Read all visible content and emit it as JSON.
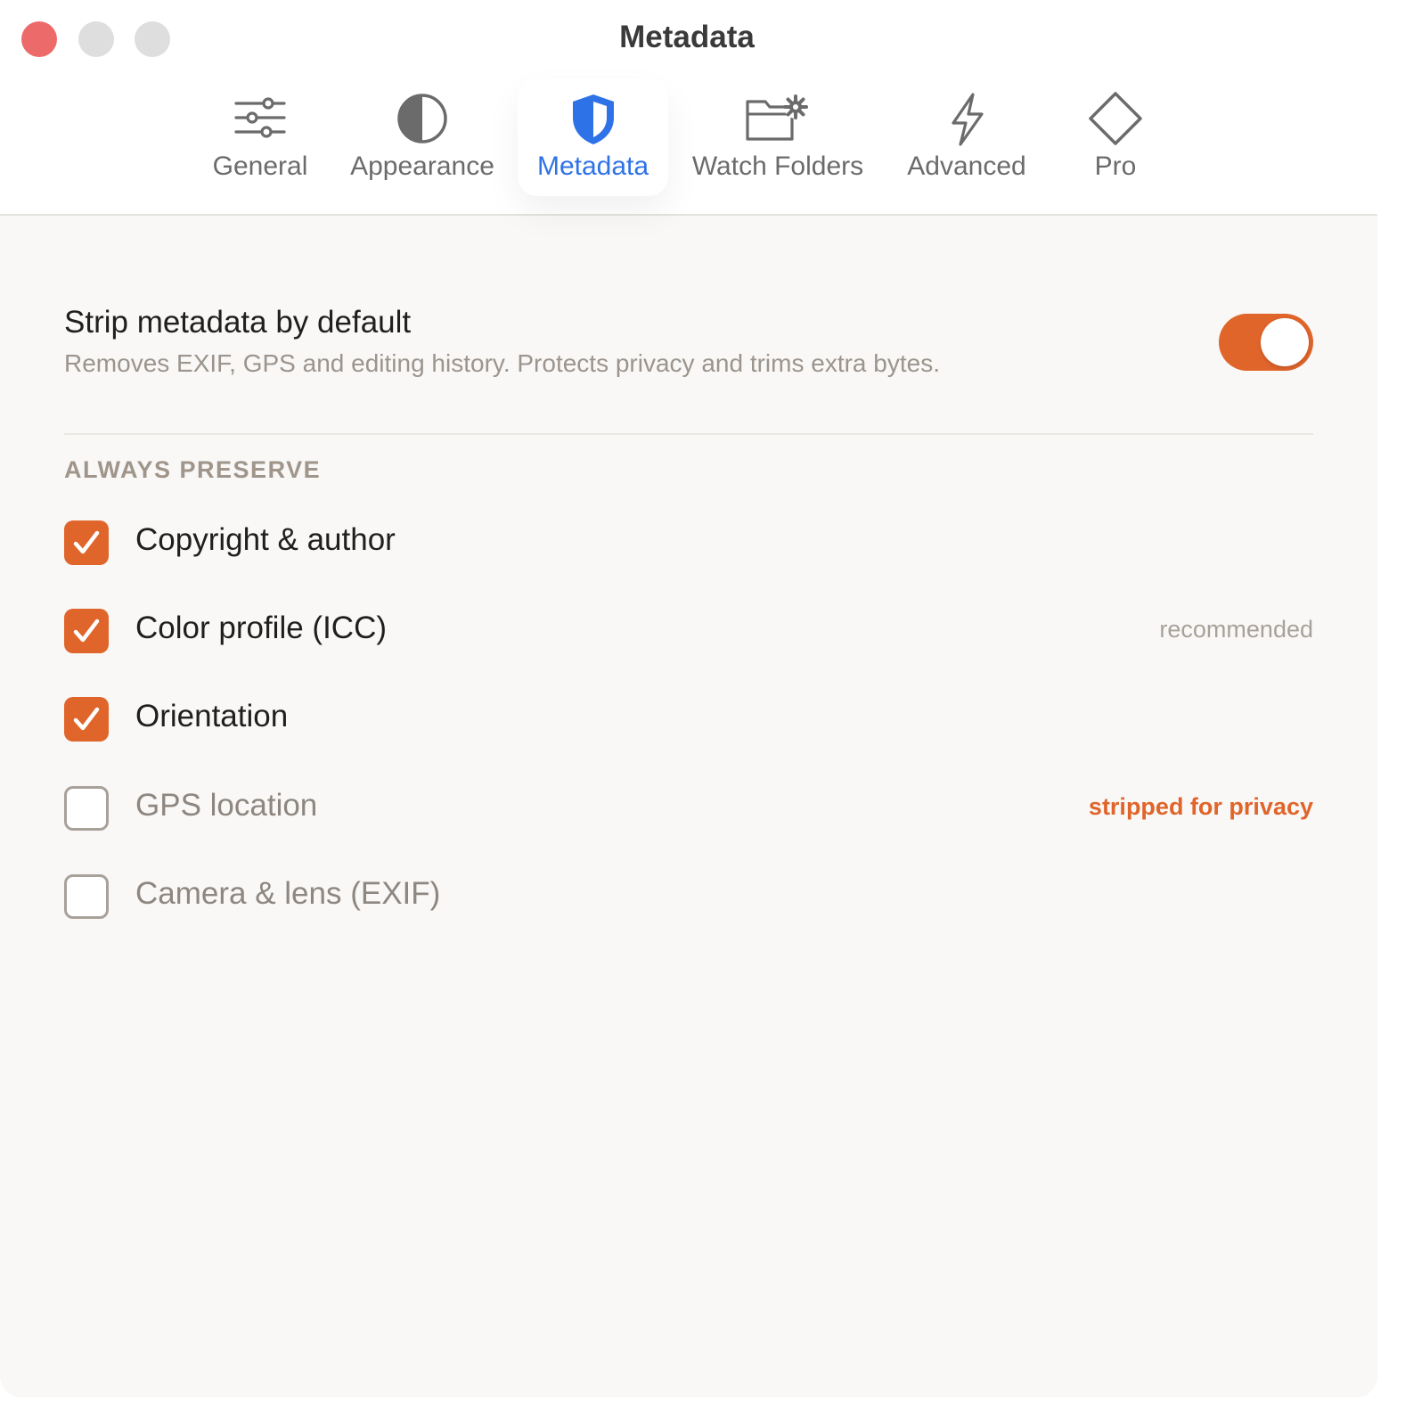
{
  "window": {
    "title": "Metadata"
  },
  "tabs": [
    {
      "label": "General",
      "icon": "sliders-icon"
    },
    {
      "label": "Appearance",
      "icon": "half-circle-icon"
    },
    {
      "label": "Metadata",
      "icon": "shield-icon",
      "selected": true
    },
    {
      "label": "Watch Folders",
      "icon": "folder-gear-icon"
    },
    {
      "label": "Advanced",
      "icon": "bolt-icon"
    },
    {
      "label": "Pro",
      "icon": "diamond-icon"
    }
  ],
  "strip": {
    "title": "Strip metadata by default",
    "description": "Removes EXIF, GPS and editing history. Protects privacy and trims extra bytes.",
    "enabled": true
  },
  "preserve": {
    "header": "ALWAYS PRESERVE",
    "options": [
      {
        "label": "Copyright & author",
        "checked": true,
        "note": ""
      },
      {
        "label": "Color profile (ICC)",
        "checked": true,
        "note": "recommended"
      },
      {
        "label": "Orientation",
        "checked": true,
        "note": ""
      },
      {
        "label": "GPS location",
        "checked": false,
        "note": "stripped for privacy"
      },
      {
        "label": "Camera & lens (EXIF)",
        "checked": false,
        "note": ""
      }
    ]
  },
  "colors": {
    "accent": "#e0652b",
    "selected_tab": "#2e72e8",
    "close_button": "#ec6a6a"
  }
}
